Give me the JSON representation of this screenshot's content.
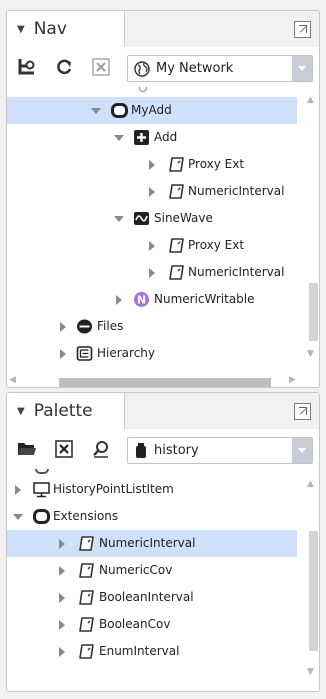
{
  "nav": {
    "title": "Nav",
    "network_label": "My Network",
    "tree": [
      {
        "label": "MyAdd",
        "icon": "component-icon",
        "expanded": true,
        "selected": true
      },
      {
        "label": "Add",
        "icon": "add-block-icon",
        "expanded": true
      },
      {
        "label": "Proxy Ext",
        "icon": "extension-icon",
        "expanded": false
      },
      {
        "label": "NumericInterval",
        "icon": "extension-icon",
        "expanded": false
      },
      {
        "label": "SineWave",
        "icon": "sinewave-icon",
        "expanded": true
      },
      {
        "label": "Proxy Ext",
        "icon": "extension-icon",
        "expanded": false
      },
      {
        "label": "NumericInterval",
        "icon": "extension-icon",
        "expanded": false
      },
      {
        "label": "NumericWritable",
        "icon": "numeric-writable-icon",
        "expanded": false
      },
      {
        "label": "Files",
        "icon": "files-icon",
        "expanded": false
      },
      {
        "label": "Hierarchy",
        "icon": "hierarchy-icon",
        "expanded": false
      }
    ]
  },
  "palette": {
    "title": "Palette",
    "module_label": "history",
    "tree": [
      {
        "label": "HistoryPointListItem",
        "icon": "monitor-icon",
        "expanded": false
      },
      {
        "label": "Extensions",
        "icon": "component-icon",
        "expanded": true
      },
      {
        "label": "NumericInterval",
        "icon": "extension-icon",
        "expanded": false,
        "selected": true
      },
      {
        "label": "NumericCov",
        "icon": "extension-icon",
        "expanded": false
      },
      {
        "label": "BooleanInterval",
        "icon": "extension-icon",
        "expanded": false
      },
      {
        "label": "BooleanCov",
        "icon": "extension-icon",
        "expanded": false
      },
      {
        "label": "EnumInterval",
        "icon": "extension-icon",
        "expanded": false
      }
    ]
  },
  "colors": {
    "selection": "#cfe0fa",
    "writable_purple": "#a672d8"
  }
}
